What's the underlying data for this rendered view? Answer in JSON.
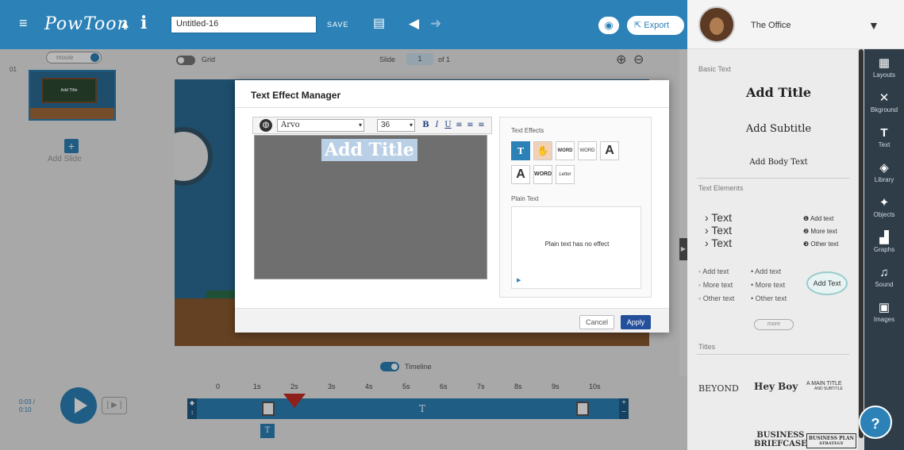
{
  "app": {
    "logo_text": "PowToon",
    "project_title": "Untitled-16",
    "save_label": "SAVE",
    "export_label": "Export",
    "account_name": "The Office"
  },
  "slides": {
    "movie_toggle_label": "movie",
    "slide_number": "01",
    "thumb_title": "Add Title",
    "add_slide_label": "Add Slide"
  },
  "canvas": {
    "grid_label": "Grid",
    "slide_label": "Slide",
    "slide_current": "1",
    "slide_total_label": "of 1"
  },
  "modal": {
    "title": "Text Effect Manager",
    "font_name": "Arvo",
    "font_size": "36",
    "format_buttons": [
      "B",
      "I",
      "U",
      "≡",
      "≡",
      "≡"
    ],
    "editor_text": "Add Title",
    "effects_label": "Text Effects",
    "effects": [
      "T",
      "hand",
      "WORD",
      "WORD",
      "A",
      "A",
      "WORD",
      "Letter"
    ],
    "plain_text_label": "Plain Text",
    "plain_text_message": "Plain text has no effect",
    "cancel_label": "Cancel",
    "apply_label": "Apply"
  },
  "right_panel": {
    "basic_text_label": "Basic Text",
    "add_title": "Add Title",
    "add_subtitle": "Add Subtitle",
    "add_body_text": "Add Body Text",
    "text_elements_label": "Text Elements",
    "text_col": [
      "› Text",
      "› Text",
      "› Text"
    ],
    "numbered": [
      "Add text",
      "More text",
      "Other text"
    ],
    "bullet_col1": [
      "◦ Add text",
      "◦ More text",
      "◦ Other text"
    ],
    "bullet_col2": [
      "• Add text",
      "• More text",
      "• Other text"
    ],
    "bubble_text": "Add Text",
    "more_label": "more",
    "titles_label": "Titles",
    "title_samples": [
      "BEYOND",
      "Hey Boy",
      "A MAIN TITLE",
      "AND SUBTITLE",
      "BUSINESS",
      "BRIEFCASE",
      "BUSINESS PLAN",
      "STRATEGY"
    ]
  },
  "tools": [
    {
      "label": "Layouts",
      "icon": "layouts-icon"
    },
    {
      "label": "Bkground",
      "icon": "background-icon"
    },
    {
      "label": "Text",
      "icon": "text-icon"
    },
    {
      "label": "Library",
      "icon": "library-icon"
    },
    {
      "label": "Objects",
      "icon": "objects-icon"
    },
    {
      "label": "Graphs",
      "icon": "graphs-icon"
    },
    {
      "label": "Sound",
      "icon": "sound-icon"
    },
    {
      "label": "Images",
      "icon": "images-icon"
    }
  ],
  "timeline": {
    "toggle_label": "Timeline",
    "current_time": "0:03 /",
    "total_time": "0:10",
    "ticks": [
      "0",
      "1s",
      "2s",
      "3s",
      "4s",
      "5s",
      "6s",
      "7s",
      "8s",
      "9s",
      "10s"
    ],
    "track_label": "T",
    "element_label": "T"
  },
  "help_label": "?",
  "colors": {
    "brand": "#2c82b7",
    "apply": "#244f9b",
    "playhead": "#c62b25",
    "sidebar": "#2f3d49"
  }
}
